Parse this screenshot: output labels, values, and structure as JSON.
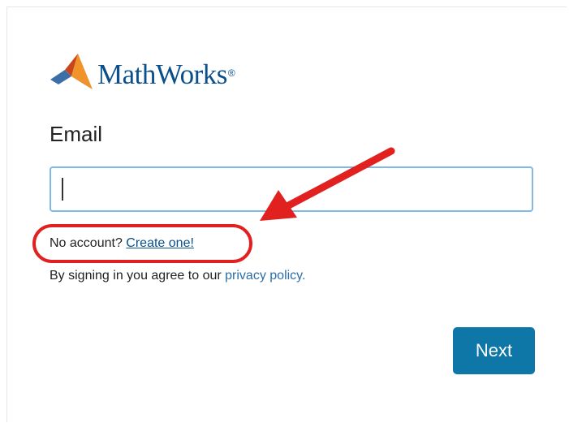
{
  "logo": {
    "text": "MathWorks",
    "registered": "®",
    "icon": "mathworks-membrane-icon"
  },
  "form": {
    "email_label": "Email",
    "email_value": "",
    "no_account_text": "No account?",
    "create_link": "Create one!",
    "agree_text": "By signing in you agree to our",
    "privacy_link": "privacy policy.",
    "next_label": "Next"
  },
  "annotation": {
    "color": "#e0211f",
    "icon": "annotation-arrow-icon"
  },
  "colors": {
    "brand": "#0a4f8a",
    "button": "#0f76a8",
    "input_border": "#7fb9e6"
  }
}
